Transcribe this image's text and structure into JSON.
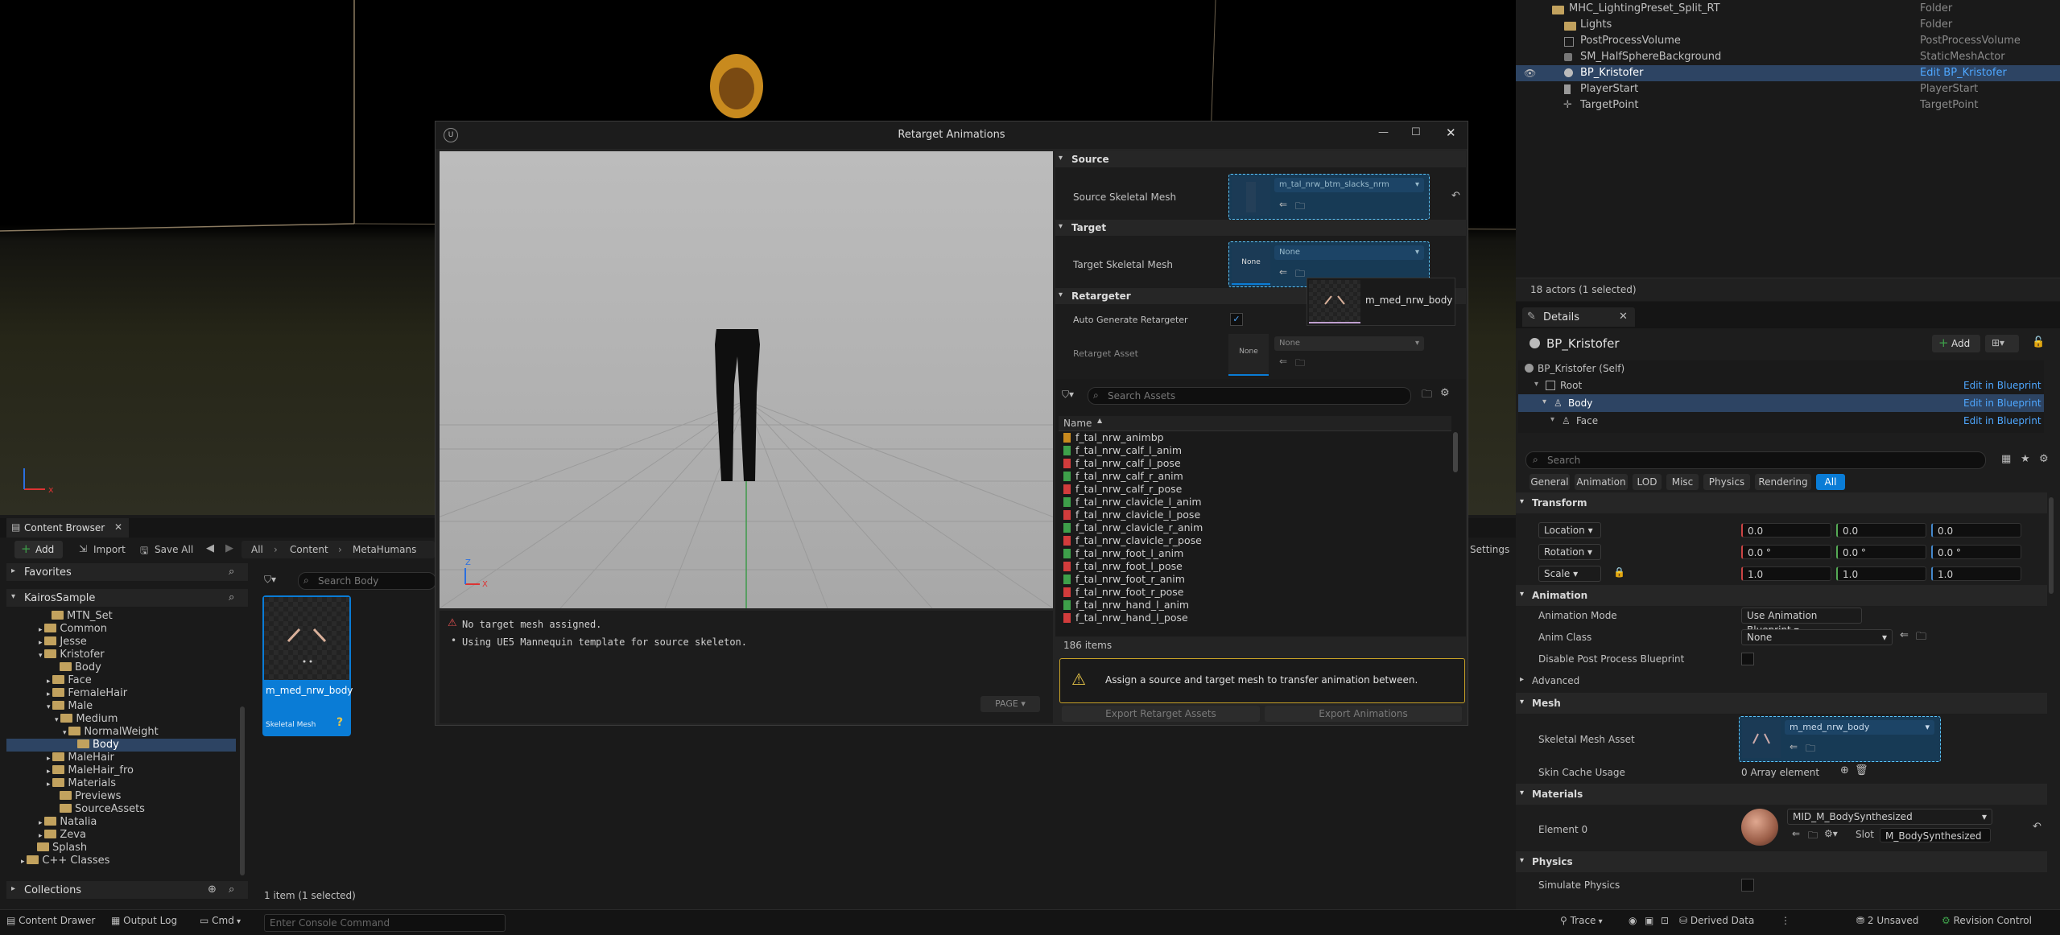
{
  "colors": {
    "accent": "#0a7cd6",
    "link": "#4ea7ff",
    "warning": "#e8c648",
    "error": "#e05050",
    "folder": "#c2a25e",
    "green_anim": "#3ea04a",
    "red_pose": "#d23c3c"
  },
  "outliner": {
    "rows": [
      {
        "name": "MHC_LightingPreset_Split_RT",
        "type": "Folder"
      },
      {
        "name": "Lights",
        "type": "Folder"
      },
      {
        "name": "PostProcessVolume",
        "type": "PostProcessVolume"
      },
      {
        "name": "SM_HalfSphereBackground",
        "type": "StaticMeshActor"
      },
      {
        "name": "BP_Kristofer",
        "type": "Edit BP_Kristofer"
      },
      {
        "name": "PlayerStart",
        "type": "PlayerStart"
      },
      {
        "name": "TargetPoint",
        "type": "TargetPoint"
      }
    ],
    "status": "18 actors (1 selected)"
  },
  "details": {
    "tab": "Details",
    "actor": "BP_Kristofer",
    "add_label": "Add",
    "components": [
      {
        "name": "BP_Kristofer (Self)",
        "link": ""
      },
      {
        "name": "Root",
        "link": "Edit in Blueprint"
      },
      {
        "name": "Body",
        "link": "Edit in Blueprint"
      },
      {
        "name": "Face",
        "link": "Edit in Blueprint"
      }
    ],
    "search_placeholder": "Search",
    "filter_tabs": [
      "General",
      "Animation",
      "LOD",
      "Misc",
      "Physics",
      "Rendering",
      "All"
    ],
    "transform": {
      "header": "Transform",
      "location_label": "Location",
      "location": [
        "0.0",
        "0.0",
        "0.0"
      ],
      "rotation_label": "Rotation",
      "rotation": [
        "0.0 °",
        "0.0 °",
        "0.0 °"
      ],
      "scale_label": "Scale",
      "scale": [
        "1.0",
        "1.0",
        "1.0"
      ]
    },
    "animation": {
      "header": "Animation",
      "mode_label": "Animation Mode",
      "mode_value": "Use Animation Blueprint",
      "class_label": "Anim Class",
      "class_value": "None",
      "disable_pp_label": "Disable Post Process Blueprint",
      "advanced": "Advanced"
    },
    "mesh": {
      "header": "Mesh",
      "asset_label": "Skeletal Mesh Asset",
      "asset_value": "m_med_nrw_body",
      "cache_label": "Skin Cache Usage",
      "cache_value": "0 Array element"
    },
    "materials": {
      "header": "Materials",
      "element_label": "Element 0",
      "element_value": "MID_M_BodySynthesized",
      "slot_label": "Slot",
      "slot_value": "M_BodySynthesized"
    },
    "physics": {
      "header": "Physics",
      "simulate_label": "Simulate Physics"
    }
  },
  "content_browser": {
    "tab": "Content Browser",
    "add": "Add",
    "import": "Import",
    "save_all": "Save All",
    "path": [
      "All",
      "Content",
      "MetaHumans"
    ],
    "settings": "Settings",
    "favorites": "Favorites",
    "root": "KairosSample",
    "tree": [
      "MTN_Set",
      "Common",
      "Jesse",
      "Kristofer",
      "Body",
      "Face",
      "FemaleHair",
      "Male",
      "Medium",
      "NormalWeight",
      "Body",
      "MaleHair",
      "MaleHair_fro",
      "Materials",
      "Previews",
      "SourceAssets",
      "Natalia",
      "Zeva",
      "Splash",
      "C++ Classes"
    ],
    "collections": "Collections",
    "search_placeholder": "Search Body",
    "asset": {
      "name": "m_med_nrw_body",
      "type": "Skeletal Mesh"
    },
    "status": "1 item (1 selected)"
  },
  "dialog": {
    "title": "Retarget Animations",
    "warning_line": "No target mesh assigned.",
    "info_line": "Using UE5 Mannequin template for source skeleton.",
    "page_btn": "PAGE",
    "source_header": "Source",
    "source_label": "Source Skeletal Mesh",
    "source_value": "m_tal_nrw_btm_slacks_nrm",
    "target_header": "Target",
    "target_label": "Target Skeletal Mesh",
    "target_value": "None",
    "none_thumb": "None",
    "retargeter_header": "Retargeter",
    "auto_label": "Auto Generate Retargeter",
    "asset_label": "Retarget Asset",
    "asset_value": "None",
    "drag_tooltip": "m_med_nrw_body",
    "search_placeholder": "Search Assets",
    "name_col": "Name",
    "assets": [
      {
        "name": "f_tal_nrw_animbp",
        "kind": "bp"
      },
      {
        "name": "f_tal_nrw_calf_l_anim",
        "kind": "anim"
      },
      {
        "name": "f_tal_nrw_calf_l_pose",
        "kind": "pose"
      },
      {
        "name": "f_tal_nrw_calf_r_anim",
        "kind": "anim"
      },
      {
        "name": "f_tal_nrw_calf_r_pose",
        "kind": "pose"
      },
      {
        "name": "f_tal_nrw_clavicle_l_anim",
        "kind": "anim"
      },
      {
        "name": "f_tal_nrw_clavicle_l_pose",
        "kind": "pose"
      },
      {
        "name": "f_tal_nrw_clavicle_r_anim",
        "kind": "anim"
      },
      {
        "name": "f_tal_nrw_clavicle_r_pose",
        "kind": "pose"
      },
      {
        "name": "f_tal_nrw_foot_l_anim",
        "kind": "anim"
      },
      {
        "name": "f_tal_nrw_foot_l_pose",
        "kind": "pose"
      },
      {
        "name": "f_tal_nrw_foot_r_anim",
        "kind": "anim"
      },
      {
        "name": "f_tal_nrw_foot_r_pose",
        "kind": "pose"
      },
      {
        "name": "f_tal_nrw_hand_l_anim",
        "kind": "anim"
      },
      {
        "name": "f_tal_nrw_hand_l_pose",
        "kind": "pose"
      }
    ],
    "items_count": "186 items",
    "banner": "Assign a source and target mesh to transfer animation between.",
    "export_retarget": "Export Retarget Assets",
    "export_anims": "Export Animations"
  },
  "bottombar": {
    "content_drawer": "Content Drawer",
    "output_log": "Output Log",
    "cmd": "Cmd",
    "console_placeholder": "Enter Console Command",
    "trace": "Trace",
    "derived": "Derived Data",
    "unsaved": "2 Unsaved",
    "revision": "Revision Control"
  }
}
